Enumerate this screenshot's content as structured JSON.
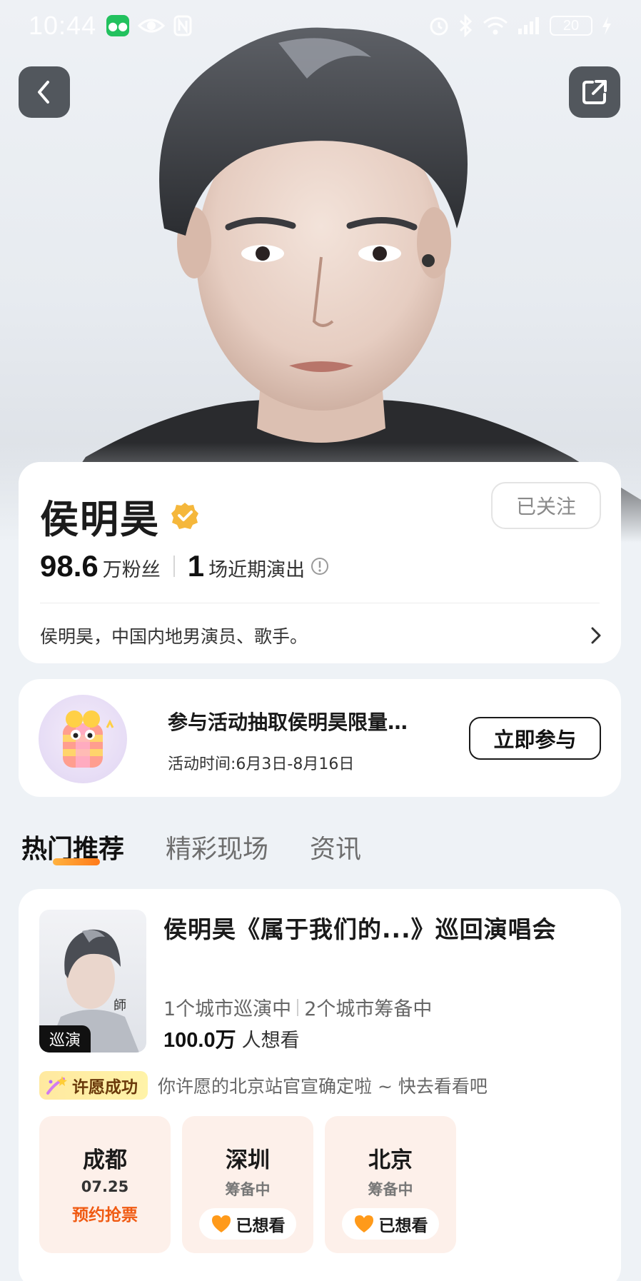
{
  "status_bar": {
    "time": "10:44",
    "battery": "20"
  },
  "nav": {
    "back_icon": "back-chevron-icon",
    "share_icon": "share-icon"
  },
  "profile": {
    "name": "侯明昊",
    "follow_label": "已关注",
    "fans_count": "98.6",
    "fans_label": "万粉丝",
    "shows_count": "1",
    "shows_label": "场近期演出",
    "bio": "侯明昊，中国内地男演员、歌手。"
  },
  "promo": {
    "title": "参与活动抽取侯明昊限量…",
    "date": "活动时间:6月3日-8月16日",
    "button_label": "立即参与"
  },
  "tabs": [
    {
      "label": "热门推荐",
      "active": true
    },
    {
      "label": "精彩现场",
      "active": false
    },
    {
      "label": "资讯",
      "active": false
    }
  ],
  "event": {
    "poster_tag": "巡演",
    "title": "侯明昊《属于我们的...》巡回演唱会",
    "touring": "1个城市巡演中",
    "preparing": "2个城市筹备中",
    "want_count": "100.0万",
    "want_label": "人想看",
    "wish_badge": "许愿成功",
    "wish_text": "你许愿的北京站官宣确定啦 ~ 快去看看吧",
    "cities": [
      {
        "name": "成都",
        "sub": "07.25",
        "action": "预约抢票"
      },
      {
        "name": "深圳",
        "sub": "筹备中",
        "pill": "已想看"
      },
      {
        "name": "北京",
        "sub": "筹备中",
        "pill": "已想看"
      }
    ]
  },
  "colors": {
    "accent_orange": "#f05a12",
    "tab_underline": "#ff8c24",
    "verified_gold": "#f5b73b"
  }
}
